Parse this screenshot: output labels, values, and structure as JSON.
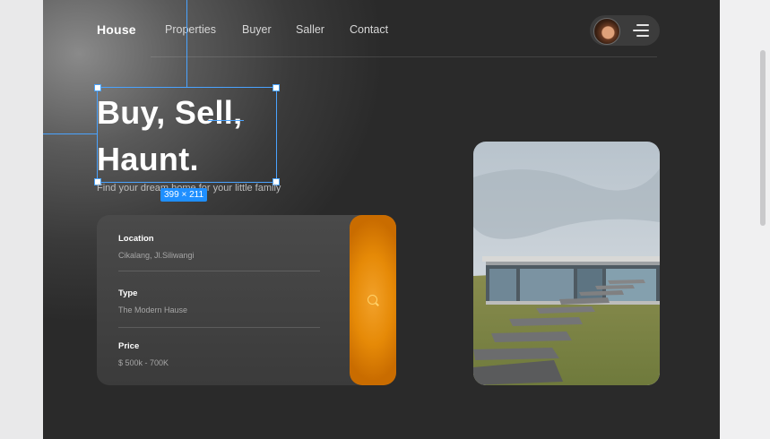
{
  "nav": {
    "brand": "House",
    "links": [
      "Properties",
      "Buyer",
      "Saller",
      "Contact"
    ]
  },
  "hero": {
    "title_line1": "Buy, Sell,",
    "title_line2": "Haunt.",
    "subtitle": "Find your dream home for your little family"
  },
  "editor": {
    "selection_size": "399 × 211"
  },
  "search": {
    "fields": [
      {
        "label": "Location",
        "value": "Cikalang, Jl.Siliwangi"
      },
      {
        "label": "Type",
        "value": "The Modern Hause"
      },
      {
        "label": "Price",
        "value": "$ 500k - 700K"
      }
    ]
  },
  "icons": {
    "menu": "hamburger-menu-icon",
    "search": "search-icon",
    "avatar": "user-avatar"
  },
  "colors": {
    "accent": "#e68a07",
    "background": "#2c2c2c",
    "selection": "#4aa3ff"
  }
}
